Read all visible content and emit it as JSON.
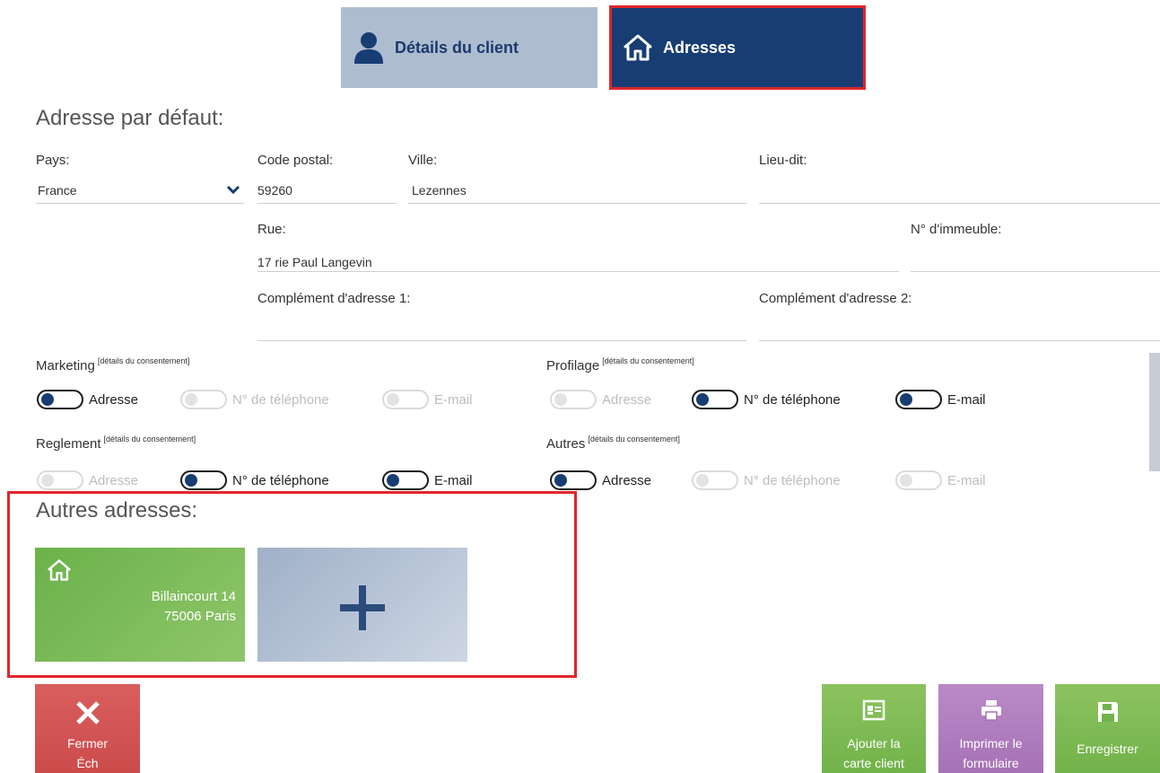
{
  "tabs": {
    "client_label": "Détails du client",
    "addresses_label": "Adresses"
  },
  "default_address": {
    "title": "Adresse par défaut:",
    "country_label": "Pays:",
    "country_value": "France",
    "postal_label": "Code postal:",
    "postal_value": "59260",
    "city_label": "Ville:",
    "city_value": "Lezennes",
    "locality_label": "Lieu-dit:",
    "locality_value": "",
    "street_label": "Rue:",
    "street_value": "17 rie Paul Langevin",
    "building_label": "N° d'immeuble:",
    "building_value": "",
    "complement1_label": "Complément d'adresse 1:",
    "complement1_value": "",
    "complement2_label": "Complément d'adresse 2:",
    "complement2_value": ""
  },
  "consents": {
    "details_link": "[détails du consentement]",
    "option_address": "Adresse",
    "option_phone": "N° de téléphone",
    "option_email": "E-mail",
    "groups": [
      {
        "title": "Marketing",
        "address": true,
        "phone": false,
        "email": false
      },
      {
        "title": "Profilage",
        "address": false,
        "phone": true,
        "email": true
      },
      {
        "title": "Reglement",
        "address": false,
        "phone": true,
        "email": true
      },
      {
        "title": "Autres",
        "address": true,
        "phone": false,
        "email": false
      }
    ]
  },
  "other_addresses": {
    "title": "Autres adresses:",
    "items": [
      {
        "line1": "Billaincourt 14",
        "line2": "75006 Paris"
      }
    ]
  },
  "buttons": {
    "close_line1": "Fermer",
    "close_line2": "Éch",
    "card_line1": "Ajouter la",
    "card_line2": "carte client",
    "print_line1": "Imprimer le",
    "print_line2": "formulaire",
    "save_label": "Enregistrer"
  },
  "colors": {
    "tab_active": "#173d72",
    "tab_inactive": "#aebcd0",
    "highlight": "#e0262b",
    "green": "#72b24a",
    "purple": "#a672b6",
    "red": "#cc4b4b"
  }
}
